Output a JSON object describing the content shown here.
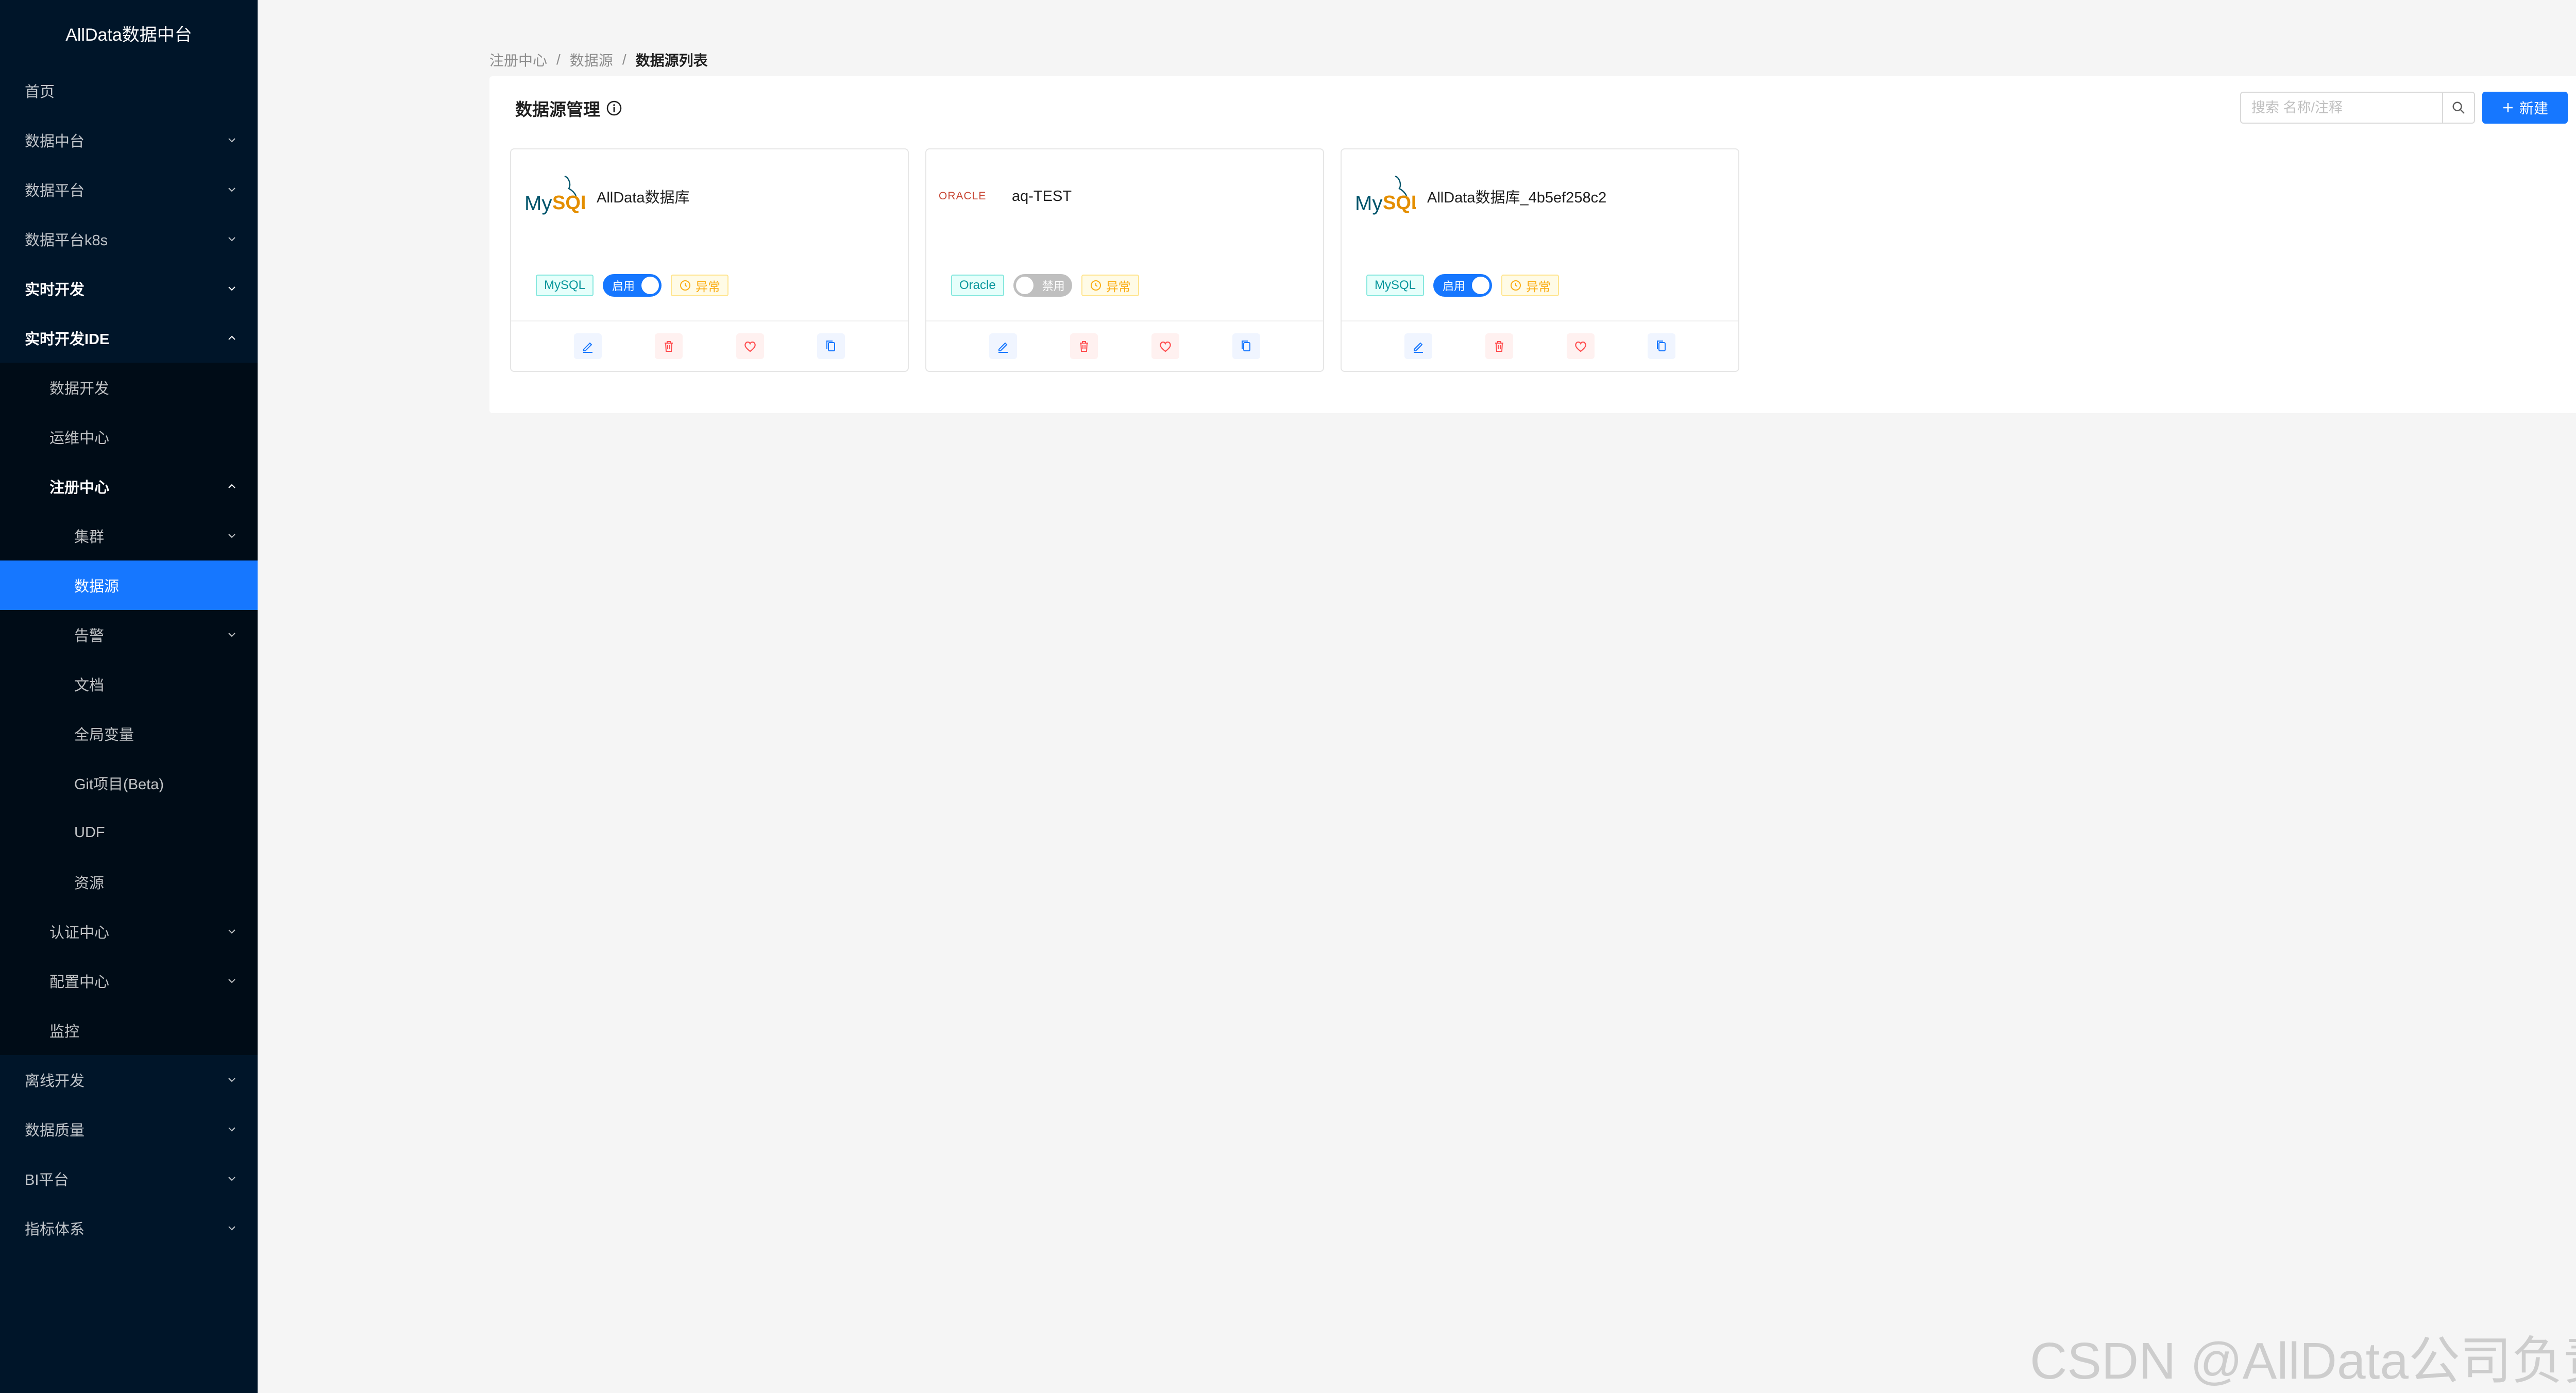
{
  "sidebar": {
    "title": "AllData数据中台",
    "items": [
      {
        "label": "首页"
      },
      {
        "label": "数据中台"
      },
      {
        "label": "数据平台"
      },
      {
        "label": "数据平台k8s"
      },
      {
        "label": "实时开发"
      },
      {
        "label": "实时开发IDE"
      },
      {
        "label": "数据开发"
      },
      {
        "label": "运维中心"
      },
      {
        "label": "注册中心"
      },
      {
        "label": "集群"
      },
      {
        "label": "数据源"
      },
      {
        "label": "告警"
      },
      {
        "label": "文档"
      },
      {
        "label": "全局变量"
      },
      {
        "label": "Git项目(Beta)"
      },
      {
        "label": "UDF"
      },
      {
        "label": "资源"
      },
      {
        "label": "认证中心"
      },
      {
        "label": "配置中心"
      },
      {
        "label": "监控"
      },
      {
        "label": "离线开发"
      },
      {
        "label": "数据质量"
      },
      {
        "label": "BI平台"
      },
      {
        "label": "指标体系"
      }
    ]
  },
  "breadcrumb": {
    "items": [
      "注册中心",
      "数据源",
      "数据源列表"
    ],
    "separator": "/"
  },
  "panel": {
    "title": "数据源管理",
    "search_placeholder": "搜索 名称/注释",
    "new_label": "新建"
  },
  "cards": [
    {
      "logo": "MySQL",
      "name": "AllData数据库",
      "type": "MySQL",
      "switch_label": "启用",
      "enabled": true,
      "status": "异常"
    },
    {
      "logo": "ORACLE",
      "name": "aq-TEST",
      "type": "Oracle",
      "switch_label": "禁用",
      "enabled": false,
      "status": "异常"
    },
    {
      "logo": "MySQL",
      "name": "AllData数据库_4b5ef258c2",
      "type": "MySQL",
      "switch_label": "启用",
      "enabled": true,
      "status": "异常"
    }
  ],
  "watermark": "CSDN @AllData公司负责人",
  "colors": {
    "sidebar_bg": "#001529",
    "sidebar_sub_bg": "#000c17",
    "primary": "#1677ff",
    "warning": "#faad14",
    "danger": "#ff4d4f",
    "oracle_red": "#c74634"
  }
}
